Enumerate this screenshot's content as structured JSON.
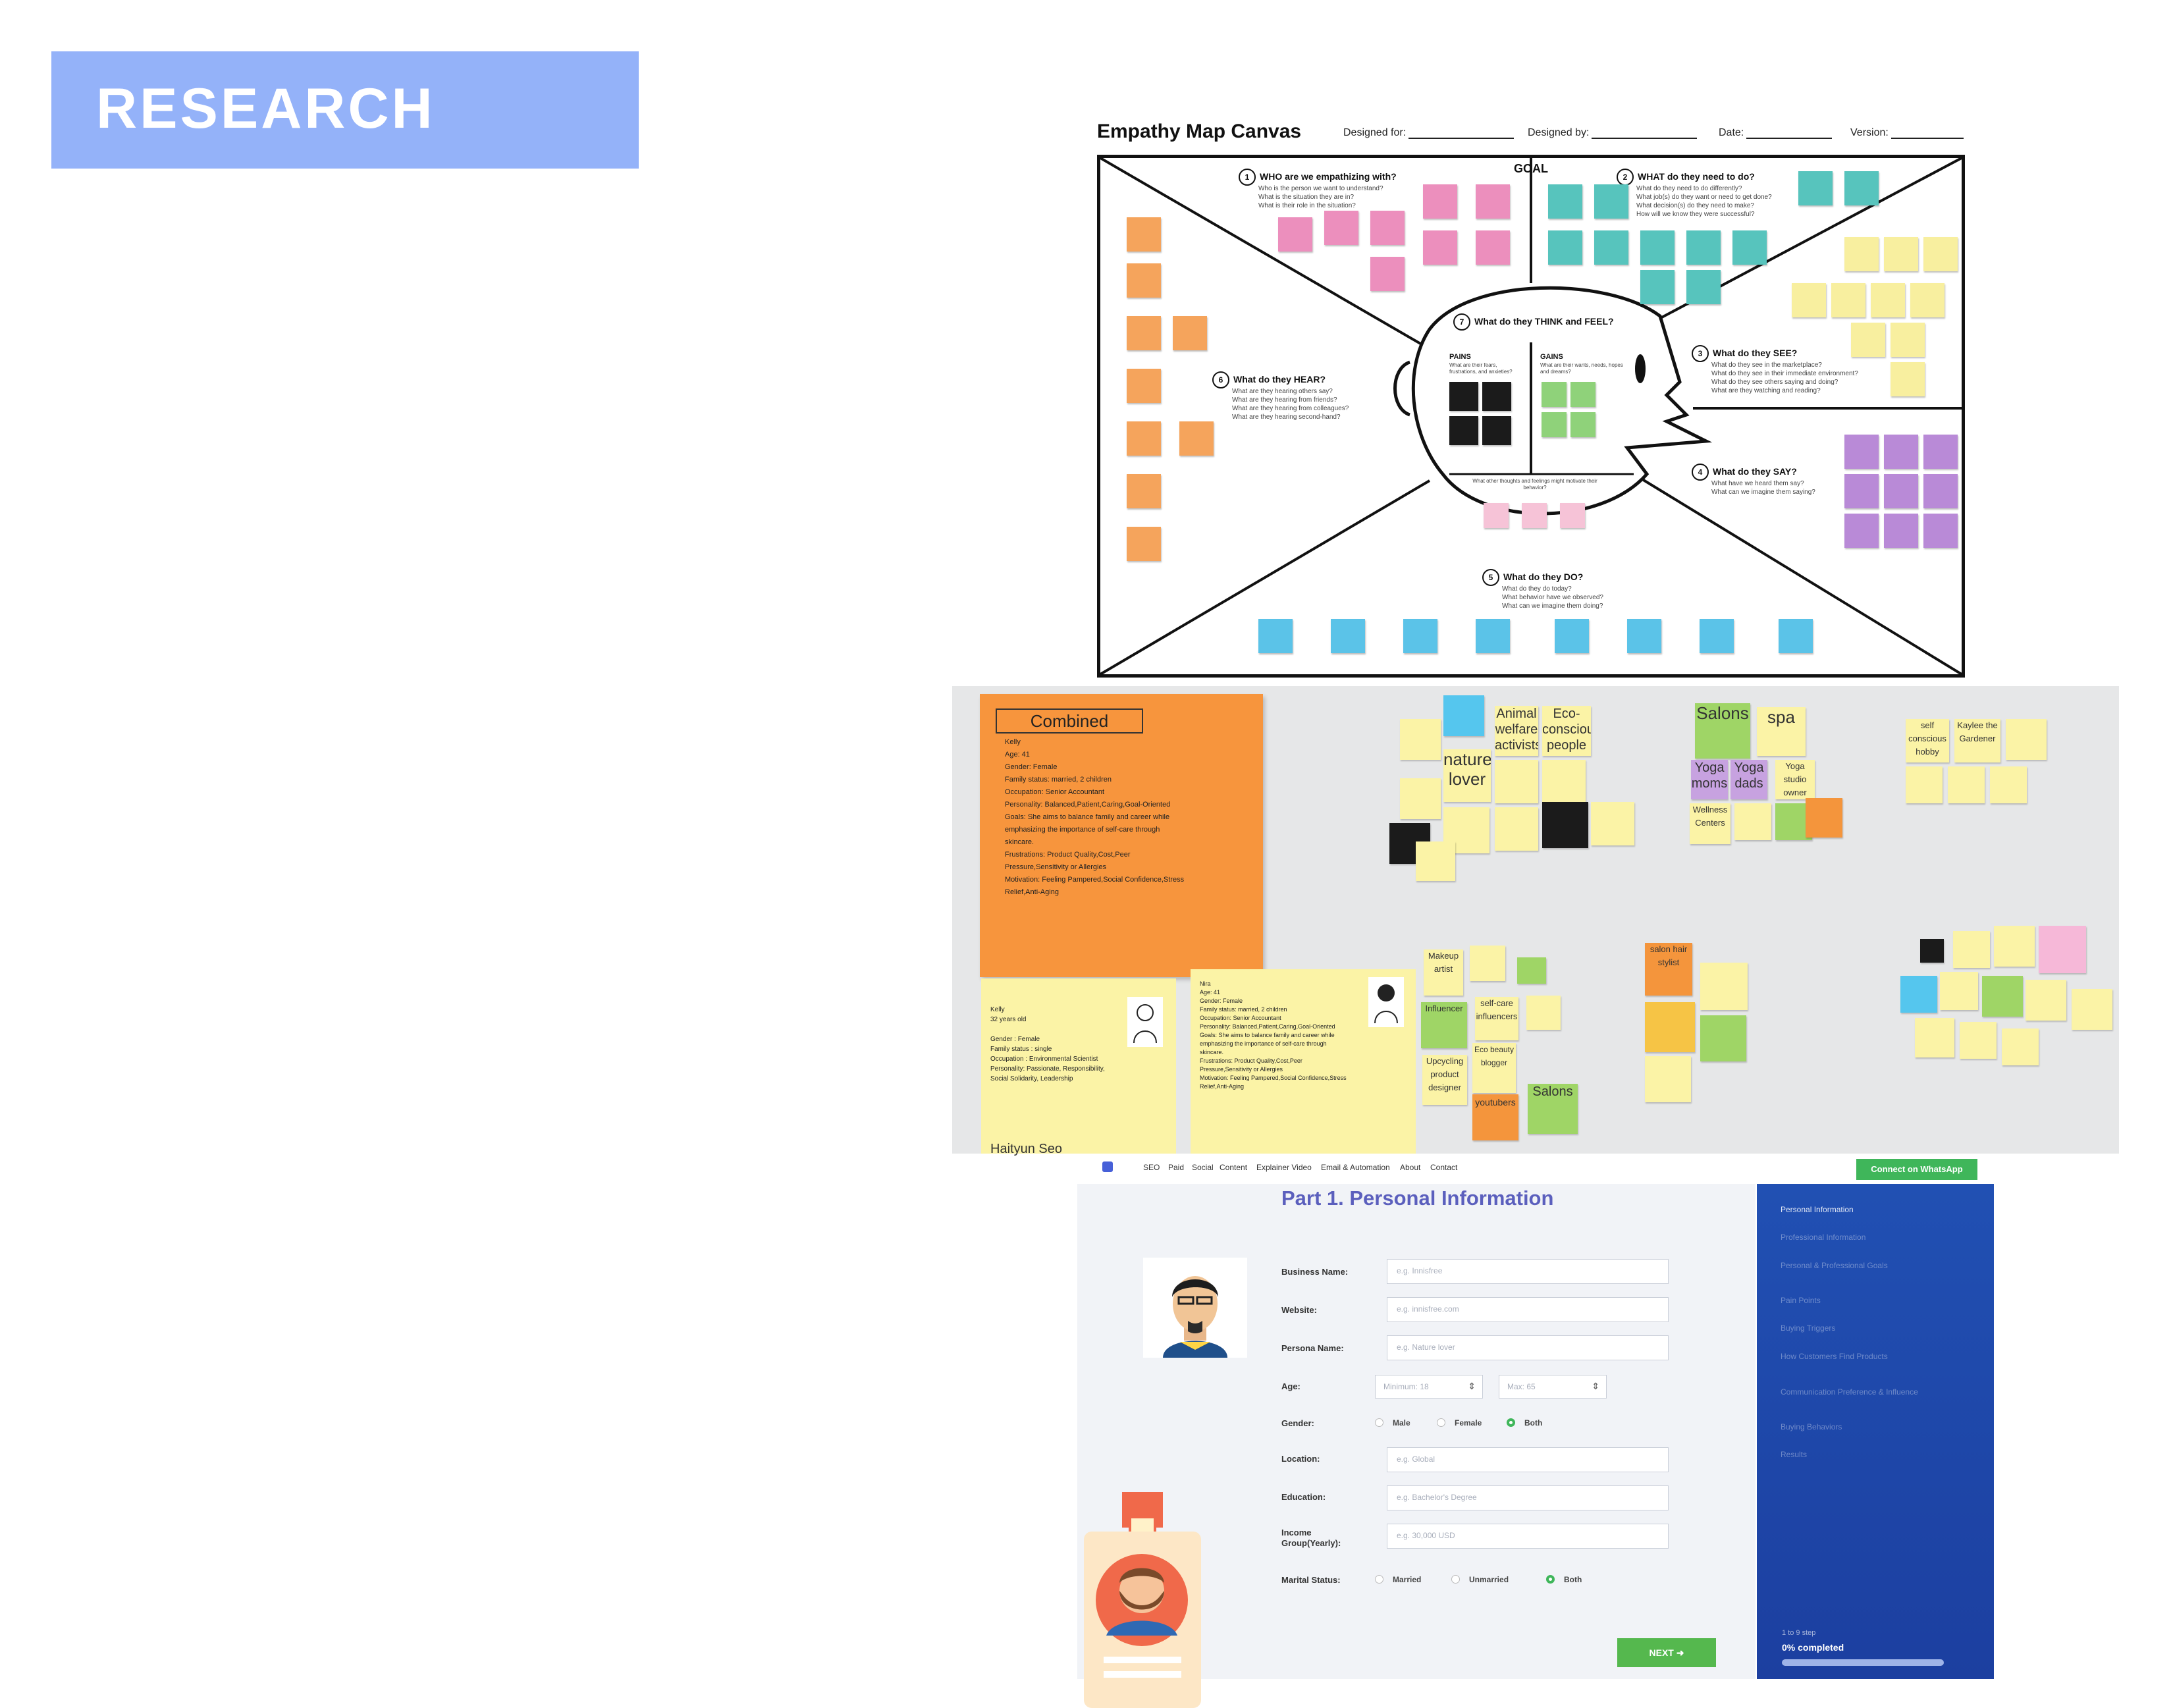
{
  "section": {
    "title": "RESEARCH"
  },
  "empathy_map": {
    "title": "Empathy Map Canvas",
    "fields": [
      "Designed for:",
      "Designed by:",
      "Date:",
      "Version:"
    ],
    "goal": "GOAL",
    "sections": [
      {
        "num": "1",
        "title": "WHO are we empathizing with?",
        "questions": [
          "Who is the person we want to understand?",
          "What is the situation they are in?",
          "What is their role in the situation?"
        ]
      },
      {
        "num": "2",
        "title": "WHAT do they need to do?",
        "questions": [
          "What do they need to do differently?",
          "What job(s) do they want or need to get done?",
          "What decision(s) do they need to make?",
          "How will we know they were successful?"
        ]
      },
      {
        "num": "3",
        "title": "What do they SEE?",
        "questions": [
          "What do they see in the marketplace?",
          "What do they see in their immediate environment?",
          "What do they see others saying and doing?",
          "What are they watching and reading?"
        ]
      },
      {
        "num": "4",
        "title": "What do they SAY?",
        "questions": [
          "What have we heard them say?",
          "What can we imagine them saying?"
        ]
      },
      {
        "num": "5",
        "title": "What do they DO?",
        "questions": [
          "What do they do today?",
          "What behavior have we observed?",
          "What can we imagine them doing?"
        ]
      },
      {
        "num": "6",
        "title": "What do they HEAR?",
        "questions": [
          "What are they hearing others say?",
          "What are they hearing from friends?",
          "What are they hearing from colleagues?",
          "What are they hearing second-hand?"
        ]
      },
      {
        "num": "7",
        "title": "What do they THINK and FEEL?",
        "questions": []
      }
    ],
    "pains": "PAINS",
    "pains_q": "What are their fears, frustrations, and anxieties?",
    "gains": "GAINS",
    "gains_q": "What are their wants, needs, hopes and dreams?",
    "think_q": "What other thoughts and feelings might motivate their behavior?"
  },
  "board": {
    "combined": {
      "title": "Combined",
      "text": "Kelly\nAge: 41\nGender: Female\nFamily status: married, 2 children\nOccupation: Senior Accountant\nPersonality: Balanced,Patient,Caring,Goal-Oriented\nGoals: She aims to balance family and career while\nemphasizing the importance of self-care through\nskincare.\nFrustrations: Product Quality,Cost,Peer\nPressure,Sensitivity or Allergies\nMotivation: Feeling Pampered,Social Confidence,Stress\nRelief,Anti-Aging"
    },
    "kelly": {
      "text": "Kelly\n32 years old\n\nGender : Female\nFamily status : single\nOccupation : Environmental Scientist\nPersonality: Passionate, Responsibility,\nSocial Solidarity, Leadership"
    },
    "nira": {
      "text": "Nira\nAge: 41\nGender: Female\nFamily status: married, 2 children\nOccupation: Senior Accountant\nPersonality: Balanced,Patient,Caring,Goal-Oriented\nGoals: She aims to balance family and career while\nemphasizing the importance of self-care through\nskincare.\nFrustrations: Product Quality,Cost,Peer\nPressure,Sensitivity or Allergies\nMotivation: Feeling Pampered,Social Confidence,Stress\nRelief,Anti-Aging"
    },
    "signature": "Haityun Seo",
    "notes": {
      "animal_welfare": "Animal welfare activists",
      "eco_conscious": "Eco-conscious people",
      "nature_lover": "nature lover",
      "salons1": "Salons",
      "spa": "spa",
      "yoga_moms": "Yoga moms",
      "yoga_dads": "Yoga dads",
      "yoga_studio": "Yoga studio owner",
      "wellness": "Wellness Centers",
      "self_conscious": "self conscious hobby",
      "kaylee": "Kaylee the Gardener",
      "makeup": "Makeup artist",
      "influencer": "Influencer",
      "self_care": "self-care influencers",
      "upcycling": "Upcycling product designer",
      "eco_beauty": "Eco beauty blogger",
      "youtubers": "youtubers",
      "salons2": "Salons",
      "hair_stylist": "salon hair stylist"
    }
  },
  "form": {
    "nav": [
      "SEO",
      "Paid",
      "Social",
      "Content",
      "Explainer Video",
      "Email & Automation",
      "About",
      "Contact"
    ],
    "whatsapp": "Connect on WhatsApp",
    "title": "Part 1. Personal Information",
    "fields": {
      "business_name": {
        "label": "Business Name:",
        "placeholder": "e.g. Innisfree"
      },
      "website": {
        "label": "Website:",
        "placeholder": "e.g. innisfree.com"
      },
      "persona_name": {
        "label": "Persona Name:",
        "placeholder": "e.g. Nature lover"
      },
      "age": {
        "label": "Age:",
        "min": "Minimum: 18",
        "max": "Max: 65"
      },
      "gender": {
        "label": "Gender:",
        "options": [
          "Male",
          "Female",
          "Both"
        ],
        "selected": "Both"
      },
      "location": {
        "label": "Location:",
        "placeholder": "e.g. Global"
      },
      "education": {
        "label": "Education:",
        "placeholder": "e.g. Bachelor's Degree"
      },
      "income": {
        "label": "Income Group(Yearly):",
        "placeholder": "e.g. 30,000 USD"
      },
      "marital": {
        "label": "Marital Status:",
        "options": [
          "Married",
          "Unmarried",
          "Both"
        ],
        "selected": "Both"
      }
    },
    "next": "NEXT ➜",
    "steps": [
      "Personal Information",
      "Professional Information",
      "Personal & Professional Goals",
      "Pain Points",
      "Buying Triggers",
      "How Customers Find Products",
      "Communication Preference & Influence",
      "Buying Behaviors",
      "Results"
    ],
    "progress": {
      "label": "1 to 9 step",
      "text": "0% completed",
      "fraction": 0.0
    }
  }
}
